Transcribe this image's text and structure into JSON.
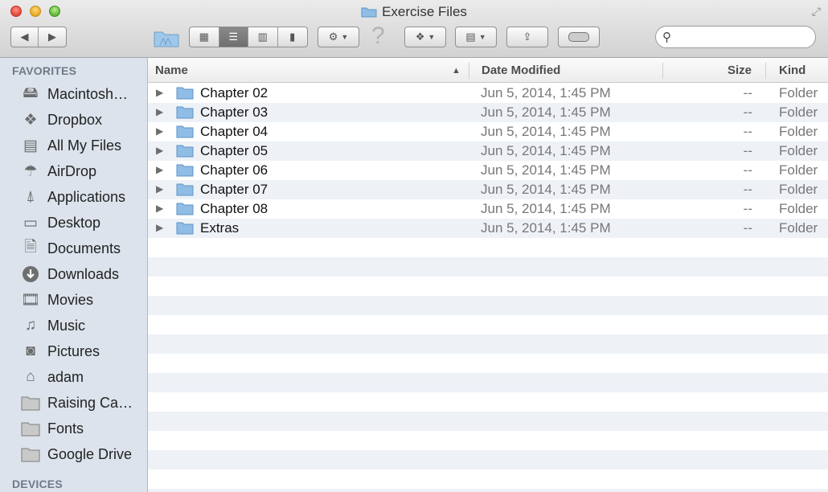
{
  "window": {
    "title": "Exercise Files"
  },
  "search": {
    "placeholder": ""
  },
  "sidebar": {
    "favorites_header": "FAVORITES",
    "devices_header": "DEVICES",
    "items": [
      {
        "label": "Macintosh…",
        "icon": "hard-drive-icon"
      },
      {
        "label": "Dropbox",
        "icon": "dropbox-icon"
      },
      {
        "label": "All My Files",
        "icon": "all-files-icon"
      },
      {
        "label": "AirDrop",
        "icon": "airdrop-icon"
      },
      {
        "label": "Applications",
        "icon": "applications-icon"
      },
      {
        "label": "Desktop",
        "icon": "desktop-icon"
      },
      {
        "label": "Documents",
        "icon": "documents-icon"
      },
      {
        "label": "Downloads",
        "icon": "downloads-icon"
      },
      {
        "label": "Movies",
        "icon": "movies-icon"
      },
      {
        "label": "Music",
        "icon": "music-icon"
      },
      {
        "label": "Pictures",
        "icon": "pictures-icon"
      },
      {
        "label": "adam",
        "icon": "home-icon"
      },
      {
        "label": "Raising Ca…",
        "icon": "folder-icon"
      },
      {
        "label": "Fonts",
        "icon": "folder-icon"
      },
      {
        "label": "Google Drive",
        "icon": "folder-icon"
      }
    ]
  },
  "columns": {
    "name": "Name",
    "date": "Date Modified",
    "size": "Size",
    "kind": "Kind"
  },
  "files": [
    {
      "name": "Chapter 02",
      "date": "Jun 5, 2014, 1:45 PM",
      "size": "--",
      "kind": "Folder"
    },
    {
      "name": "Chapter 03",
      "date": "Jun 5, 2014, 1:45 PM",
      "size": "--",
      "kind": "Folder"
    },
    {
      "name": "Chapter 04",
      "date": "Jun 5, 2014, 1:45 PM",
      "size": "--",
      "kind": "Folder"
    },
    {
      "name": "Chapter 05",
      "date": "Jun 5, 2014, 1:45 PM",
      "size": "--",
      "kind": "Folder"
    },
    {
      "name": "Chapter 06",
      "date": "Jun 5, 2014, 1:45 PM",
      "size": "--",
      "kind": "Folder"
    },
    {
      "name": "Chapter 07",
      "date": "Jun 5, 2014, 1:45 PM",
      "size": "--",
      "kind": "Folder"
    },
    {
      "name": "Chapter 08",
      "date": "Jun 5, 2014, 1:45 PM",
      "size": "--",
      "kind": "Folder"
    },
    {
      "name": "Extras",
      "date": "Jun 5, 2014, 1:45 PM",
      "size": "--",
      "kind": "Folder"
    }
  ],
  "colors": {
    "folder_blue": "#8fbde6",
    "sidebar_bg": "#dce3ec",
    "row_alt": "#eef2f7"
  }
}
